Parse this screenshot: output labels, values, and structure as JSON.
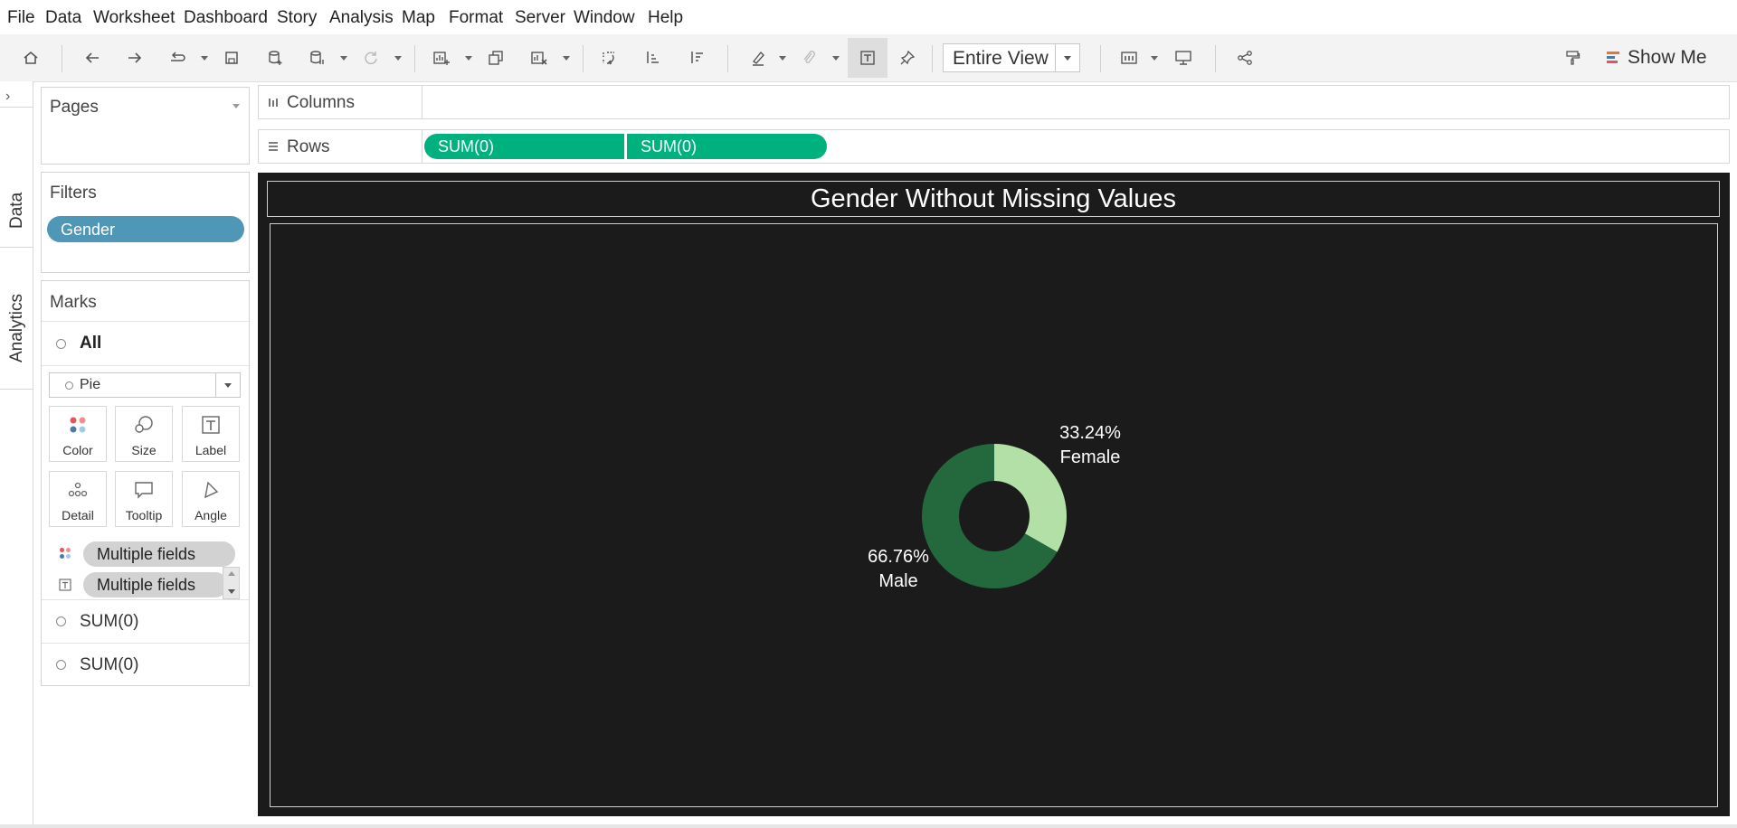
{
  "menu": [
    "File",
    "Data",
    "Worksheet",
    "Dashboard",
    "Story",
    "Analysis",
    "Map",
    "Format",
    "Server",
    "Window",
    "Help"
  ],
  "toolbar": {
    "fit_select": "Entire View",
    "show_me": "Show Me"
  },
  "side_tabs": {
    "data": "Data",
    "analytics": "Analytics"
  },
  "pages": {
    "title": "Pages"
  },
  "filters": {
    "title": "Filters",
    "items": [
      "Gender"
    ]
  },
  "marks": {
    "title": "Marks",
    "all_label": "All",
    "mark_type": "Pie",
    "buttons": [
      "Color",
      "Size",
      "Label",
      "Detail",
      "Tooltip",
      "Angle"
    ],
    "pills": [
      "Multiple fields",
      "Multiple fields"
    ],
    "measure_rows": [
      "SUM(0)",
      "SUM(0)"
    ]
  },
  "shelves": {
    "columns_label": "Columns",
    "rows_label": "Rows",
    "rows_pills": [
      "SUM(0)",
      "SUM(0)"
    ]
  },
  "colors": {
    "female": "#b3e0a6",
    "male": "#24693d",
    "view_bg": "#1b1b1b",
    "row_pill": "#00b180",
    "filter_pill": "#4e97b6"
  },
  "chart_data": {
    "type": "pie",
    "title": "Gender Without Missing Values",
    "donut": true,
    "slices": [
      {
        "category": "Female",
        "value": 33.24,
        "label_value": "33.24%"
      },
      {
        "category": "Male",
        "value": 66.76,
        "label_value": "66.76%"
      }
    ]
  }
}
